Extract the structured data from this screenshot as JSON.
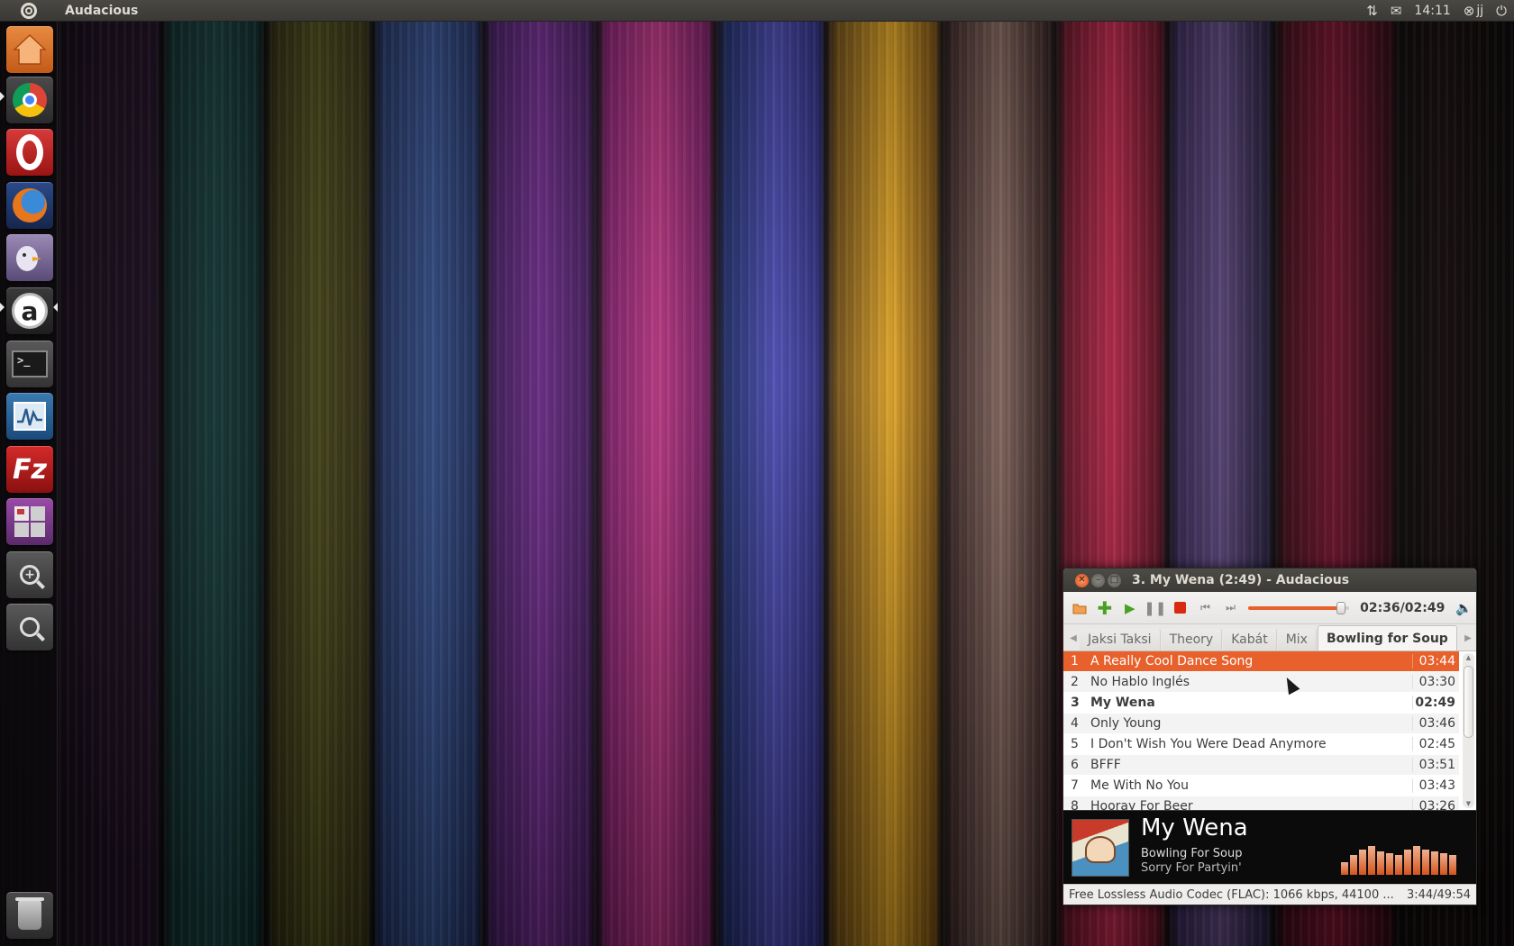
{
  "top_panel": {
    "app_title": "Audacious",
    "clock": "14:11",
    "user": "jj"
  },
  "launcher": {
    "items": [
      {
        "name": "home-folder",
        "icon": "home-folder-icon"
      },
      {
        "name": "chrome",
        "icon": "chrome-icon"
      },
      {
        "name": "opera",
        "icon": "opera-icon"
      },
      {
        "name": "firefox",
        "icon": "firefox-icon"
      },
      {
        "name": "pidgin",
        "icon": "pidgin-icon"
      },
      {
        "name": "audacious",
        "icon": "audacious-icon"
      },
      {
        "name": "terminal",
        "icon": "terminal-icon"
      },
      {
        "name": "system-monitor",
        "icon": "system-monitor-icon"
      },
      {
        "name": "filezilla",
        "icon": "filezilla-icon"
      },
      {
        "name": "workspaces",
        "icon": "workspaces-icon"
      },
      {
        "name": "zoom-in",
        "icon": "zoom-in-icon"
      },
      {
        "name": "zoom-out",
        "icon": "zoom-out-icon"
      },
      {
        "name": "trash",
        "icon": "trash-icon"
      }
    ],
    "terminal_prompt": ">_",
    "filezilla_glyph": "Fz",
    "audacious_glyph": "a"
  },
  "window": {
    "title": "3. My Wena (2:49) - Audacious",
    "accent_color": "#e8602c"
  },
  "toolbar": {
    "time": "02:36/02:49",
    "progress_fraction": 0.92
  },
  "tabs": [
    {
      "label": "Jaksi Taksi",
      "active": false
    },
    {
      "label": "Theory",
      "active": false
    },
    {
      "label": "Kabát",
      "active": false
    },
    {
      "label": "Mix",
      "active": false
    },
    {
      "label": "Bowling for Soup",
      "active": true
    }
  ],
  "playlist": [
    {
      "num": "1",
      "title": "A Really Cool Dance Song",
      "length": "03:44",
      "selected": true,
      "current": false
    },
    {
      "num": "2",
      "title": "No Hablo Inglés",
      "length": "03:30",
      "selected": false,
      "current": false
    },
    {
      "num": "3",
      "title": "My Wena",
      "length": "02:49",
      "selected": false,
      "current": true
    },
    {
      "num": "4",
      "title": "Only Young",
      "length": "03:46",
      "selected": false,
      "current": false
    },
    {
      "num": "5",
      "title": "I Don't Wish You Were Dead Anymore",
      "length": "02:45",
      "selected": false,
      "current": false
    },
    {
      "num": "6",
      "title": "BFFF",
      "length": "03:51",
      "selected": false,
      "current": false
    },
    {
      "num": "7",
      "title": "Me With No You",
      "length": "03:43",
      "selected": false,
      "current": false
    },
    {
      "num": "8",
      "title": "Hooray For Beer",
      "length": "03:26",
      "selected": false,
      "current": false
    }
  ],
  "now_playing": {
    "title": "My Wena",
    "artist": "Bowling For Soup",
    "album": "Sorry For Partyin'",
    "visualizer_levels": [
      0.35,
      0.55,
      0.7,
      0.8,
      0.65,
      0.6,
      0.55,
      0.7,
      0.8,
      0.7,
      0.65,
      0.6,
      0.55
    ]
  },
  "status": {
    "codec": "Free Lossless Audio Codec (FLAC): 1066 kbps, 44100 ...",
    "total": "3:44/49:54"
  }
}
